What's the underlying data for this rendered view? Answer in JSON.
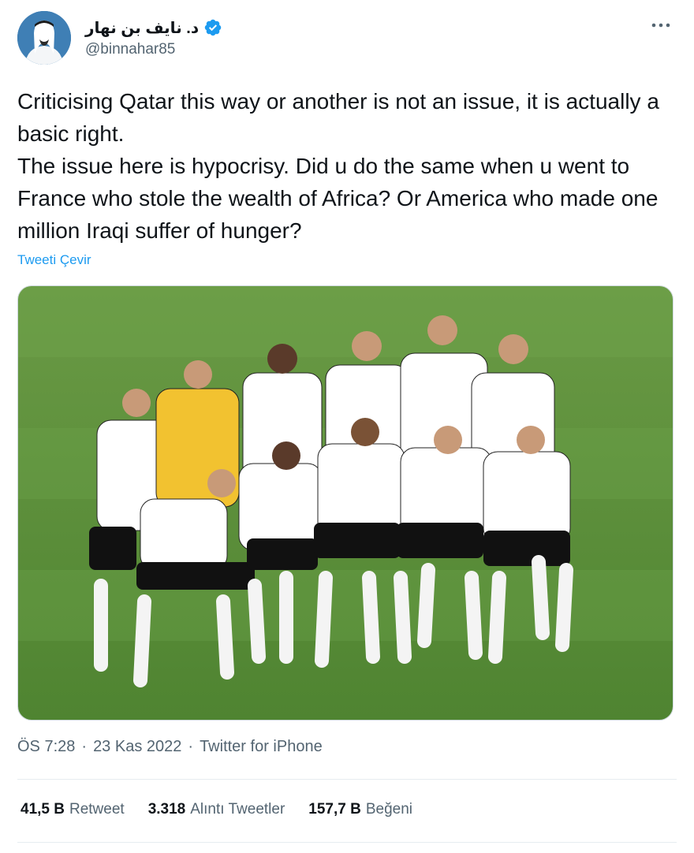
{
  "author": {
    "display_name": "د. نايف بن نهار",
    "handle": "@binnahar85",
    "verified_color": "#1d9bf0"
  },
  "more_icon": "more-horizontal-icon",
  "tweet": {
    "lines": [
      "Criticising Qatar this way or another is not an issue, it is actually a basic right.",
      "The issue here is hypocrisy. Did u do the same when u went to France who stole the wealth of Africa? Or America who made one million Iraqi suffer of hunger?"
    ],
    "translate_label": "Tweeti Çevir"
  },
  "meta": {
    "time": "ÖS 7:28",
    "sep1": "·",
    "date": "23 Kas 2022",
    "sep2": "·",
    "source": "Twitter for iPhone"
  },
  "stats": [
    {
      "number": "41,5 B",
      "label": "Retweet"
    },
    {
      "number": "3.318",
      "label": "Alıntı Tweetler"
    },
    {
      "number": "157,7 B",
      "label": "Beğeni"
    }
  ],
  "colors": {
    "accent": "#1d9bf0",
    "text": "#0f1419",
    "muted": "#536471",
    "pitch": "#5d8f3a"
  }
}
